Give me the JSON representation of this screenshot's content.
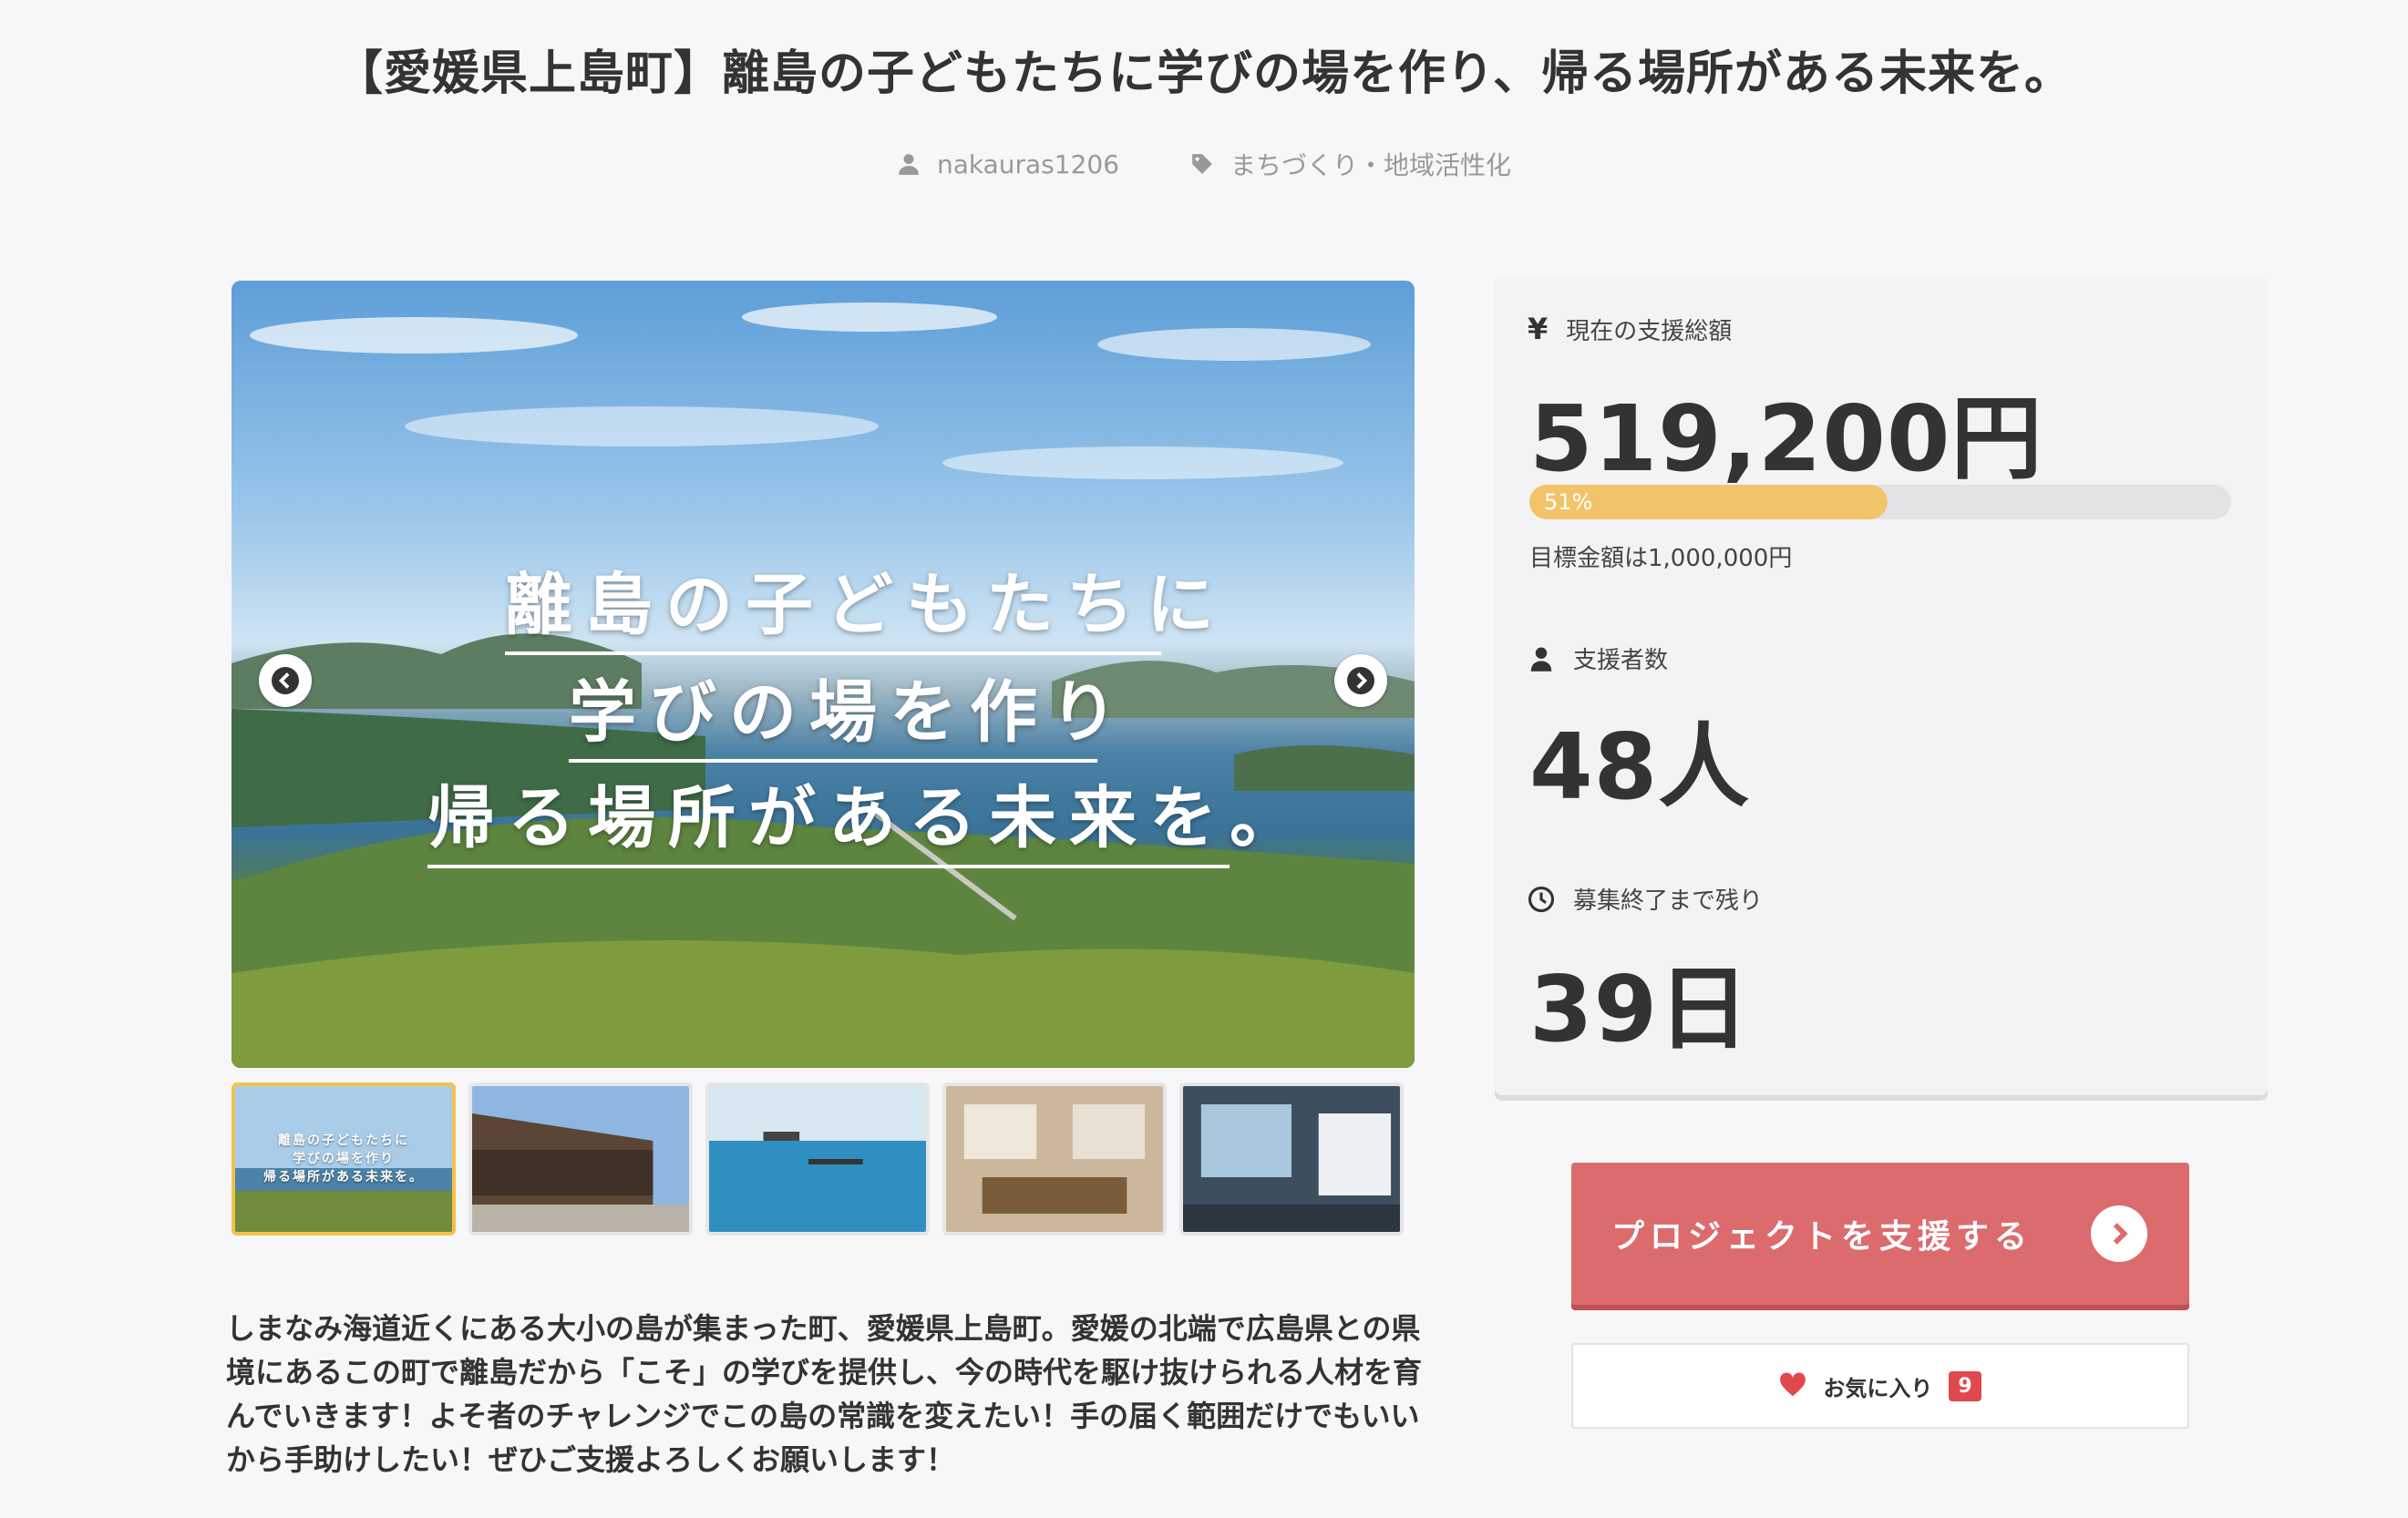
{
  "project": {
    "title": "【愛媛県上島町】離島の子どもたちに学びの場を作り、帰る場所がある未来を。",
    "author": "nakauras1206",
    "category": "まちづくり・地域活性化"
  },
  "gallery": {
    "hero_lines": [
      "離島の子どもたちに",
      "学びの場を作り",
      "帰る場所がある未来を。"
    ],
    "thumb_mini_lines": [
      "離島の子どもたちに",
      "学びの場を作り",
      "帰る場所がある未来を。"
    ],
    "thumbnail_count": 5
  },
  "description": "しまなみ海道近くにある大小の島が集まった町、愛媛県上島町。愛媛の北端で広島県との県境にあるこの町で離島だから「こそ」の学びを提供し、今の時代を駆け抜けられる人材を育んでいきます！よそ者のチャレンジでこの島の常識を変えたい！手の届く範囲だけでもいいから手助けしたい！ぜひご支援よろしくお願いします！",
  "stats": {
    "currency_icon": "¥",
    "amount_label": "現在の支援総額",
    "amount_value": "519,200円",
    "progress_percent": 51,
    "progress_label": "51%",
    "goal_text": "目標金額は1,000,000円",
    "supporters_label": "支援者数",
    "supporters_value": "48人",
    "remaining_label": "募集終了まで残り",
    "remaining_value": "39日"
  },
  "actions": {
    "support_label": "プロジェクトを支援する",
    "favorite_label": "お気に入り",
    "favorite_count": "9"
  },
  "colors": {
    "accent_red": "#dc6b6e",
    "progress_yellow": "#f2c46a",
    "badge_red": "#e0484d"
  }
}
